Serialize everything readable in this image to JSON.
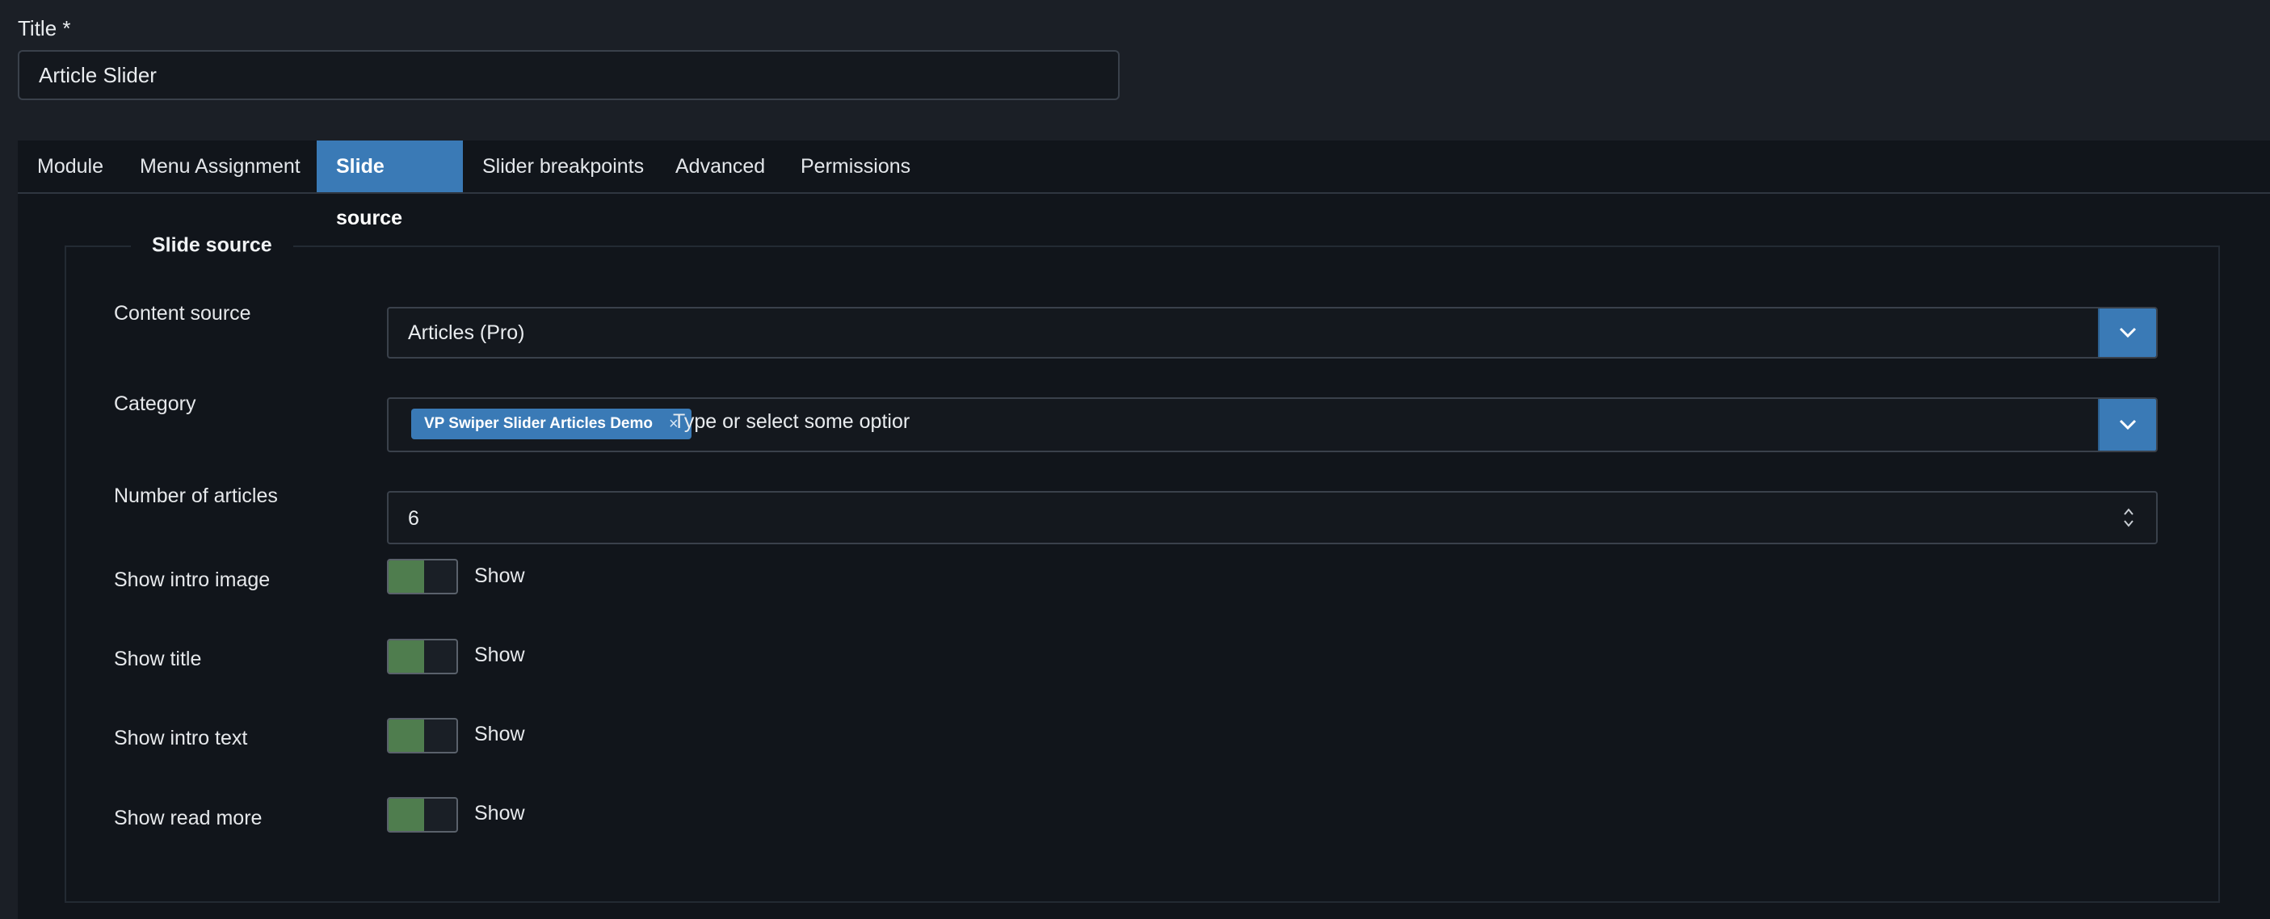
{
  "title_field": {
    "label": "Title *",
    "value": "Article Slider"
  },
  "tabs": [
    {
      "label": "Module",
      "active": false
    },
    {
      "label": "Menu Assignment",
      "active": false
    },
    {
      "label": "Slide source",
      "active": true
    },
    {
      "label": "Slider breakpoints",
      "active": false
    },
    {
      "label": "Advanced",
      "active": false
    },
    {
      "label": "Permissions",
      "active": false
    }
  ],
  "fieldset": {
    "legend": "Slide source",
    "content_source": {
      "label": "Content source",
      "value": "Articles (Pro)"
    },
    "category": {
      "label": "Category",
      "chip": "VP Swiper Slider Articles Demo",
      "chip_remove": "×",
      "placeholder": "Type or select some optior"
    },
    "number_of_articles": {
      "label": "Number of articles",
      "value": "6"
    },
    "toggles": [
      {
        "label": "Show intro image",
        "state": "Show"
      },
      {
        "label": "Show title",
        "state": "Show"
      },
      {
        "label": "Show intro text",
        "state": "Show"
      },
      {
        "label": "Show read more",
        "state": "Show"
      }
    ]
  },
  "colors": {
    "accent": "#3a7ab6",
    "toggle_on": "#4f7d4e",
    "background": "#1b1f26",
    "panel": "#11151b"
  },
  "icons": {
    "dropdown": "chevron-down-icon",
    "spinner": "up-down-arrows-icon"
  }
}
